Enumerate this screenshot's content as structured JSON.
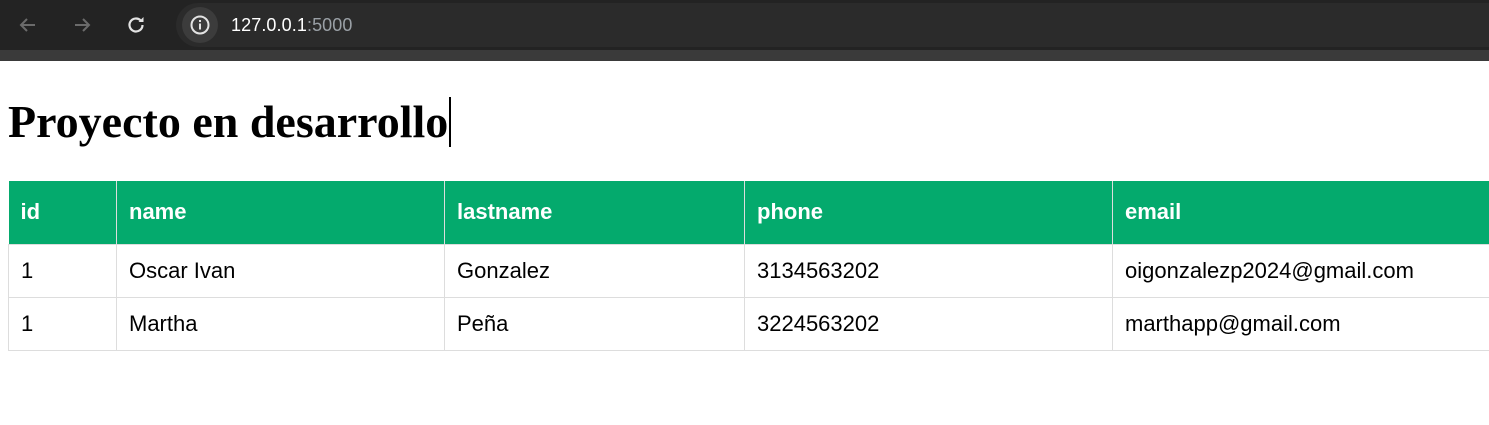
{
  "browser": {
    "url_host": "127.0.0.1",
    "url_port": ":5000",
    "icons": {
      "back": "arrow-left-icon",
      "forward": "arrow-right-icon",
      "reload": "reload-icon",
      "info": "info-icon"
    }
  },
  "page": {
    "title": "Proyecto en desarrollo"
  },
  "table": {
    "headers": [
      "id",
      "name",
      "lastname",
      "phone",
      "email"
    ],
    "rows": [
      [
        "1",
        "Oscar Ivan",
        "Gonzalez",
        "3134563202",
        "oigonzalezp2024@gmail.com"
      ],
      [
        "1",
        "Martha",
        "Peña",
        "3224563202",
        "marthapp@gmail.com"
      ]
    ],
    "header_color": "#04aa6d"
  }
}
